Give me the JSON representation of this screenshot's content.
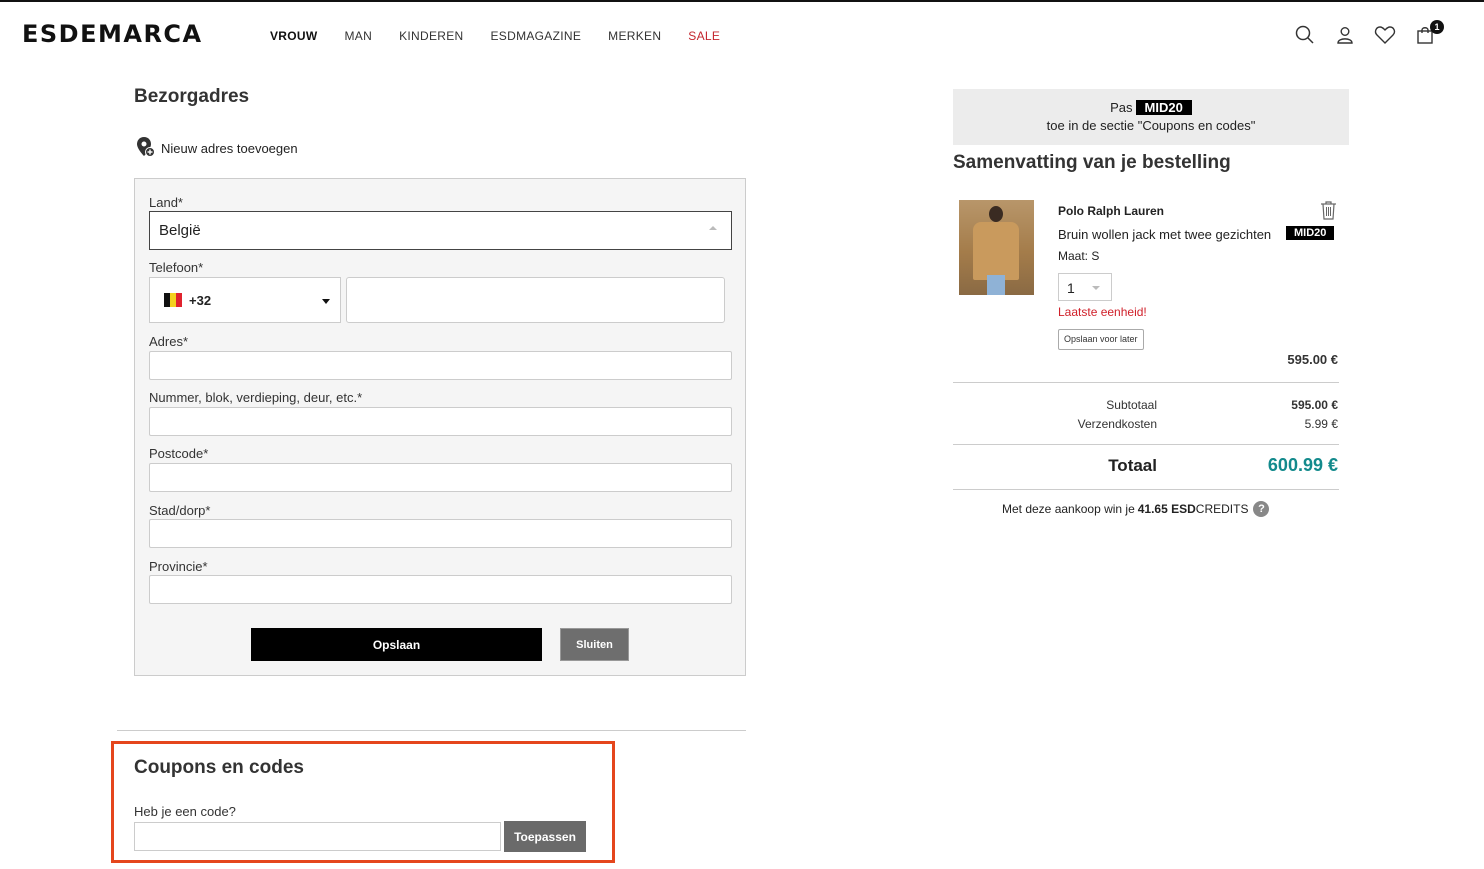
{
  "header": {
    "logo": "ESDEMARCA",
    "nav": [
      {
        "label": "VROUW"
      },
      {
        "label": "MAN"
      },
      {
        "label": "KINDEREN"
      },
      {
        "label": "ESDMAGAZINE"
      },
      {
        "label": "MERKEN"
      },
      {
        "label": "SALE"
      }
    ],
    "icons": [
      "search-icon",
      "user-icon",
      "heart-icon",
      "cart-icon"
    ],
    "cart_count": "1"
  },
  "address": {
    "title": "Bezorgadres",
    "add_new": "Nieuw adres toevoegen",
    "country_label": "Land*",
    "country_value": "België",
    "phone_label": "Telefoon*",
    "phone_code": "+32",
    "street_label": "Adres*",
    "number_label": "Nummer, blok, verdieping, deur, etc.*",
    "postcode_label": "Postcode*",
    "city_label": "Stad/dorp*",
    "province_label": "Provincie*",
    "save_label": "Opslaan",
    "close_label": "Sluiten"
  },
  "coupon": {
    "title": "Coupons en codes",
    "question": "Heb je een code?",
    "apply_label": "Toepassen"
  },
  "promo": {
    "prefix": "Pas",
    "code": "MID20",
    "suffix": "toe in de sectie \"Coupons en codes\""
  },
  "summary": {
    "title": "Samenvatting van je bestelling",
    "product": {
      "brand": "Polo Ralph Lauren",
      "name": "Bruin wollen jack met twee gezichten",
      "badge": "MID20",
      "size": "Maat: S",
      "quantity": "1",
      "stock_warning": "Laatste eenheid!",
      "save_later": "Opslaan voor later",
      "price": "595.00 €"
    },
    "subtotal_label": "Subtotaal",
    "subtotal_value": "595.00 €",
    "shipping_label": "Verzendkosten",
    "shipping_value": "5.99 €",
    "total_label": "Totaal",
    "total_value": "600.99 €",
    "credits_prefix": "Met deze aankoop win je",
    "credits_amount": "41.65 ESD",
    "credits_suffix": "CREDITS"
  },
  "colors": {
    "accent_total": "#138a8c",
    "sale": "#c4262e",
    "highlight_border": "#e5461c",
    "warning": "#d0202a"
  }
}
